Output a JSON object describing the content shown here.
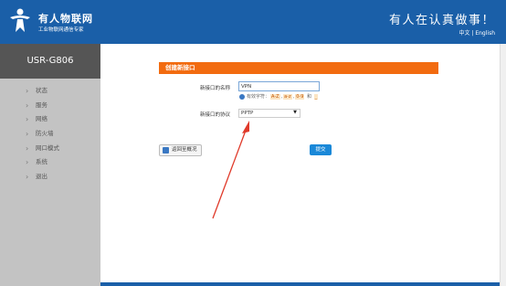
{
  "header": {
    "brand_name": "有人物联网",
    "brand_sub": "工业物联网通信专家",
    "slogan": "有人在认真做事！",
    "lang_cn": "中文",
    "lang_sep": " | ",
    "lang_en": "English"
  },
  "sidebar": {
    "model": "USR-G806",
    "items": [
      {
        "label": "状态"
      },
      {
        "label": "服务"
      },
      {
        "label": "网络"
      },
      {
        "label": "防火墙"
      },
      {
        "label": "网口模式"
      },
      {
        "label": "系统"
      },
      {
        "label": "退出"
      }
    ]
  },
  "form": {
    "title": "创建新接口",
    "name_label": "新接口的名称",
    "name_value": "VPN",
    "hint_prefix": "有效字符：",
    "hint_chips": [
      "A-Z",
      "a-z",
      "0-9",
      "_"
    ],
    "hint_and": "和",
    "protocol_label": "新接口的协议",
    "protocol_value": "PPTP",
    "back_label": "返回至概况",
    "submit_label": "提交"
  },
  "colors": {
    "header_bg": "#1a5fa8",
    "accent_orange": "#f26b0f",
    "submit_blue": "#1a88d8",
    "annotation_red": "#e03a2a"
  }
}
